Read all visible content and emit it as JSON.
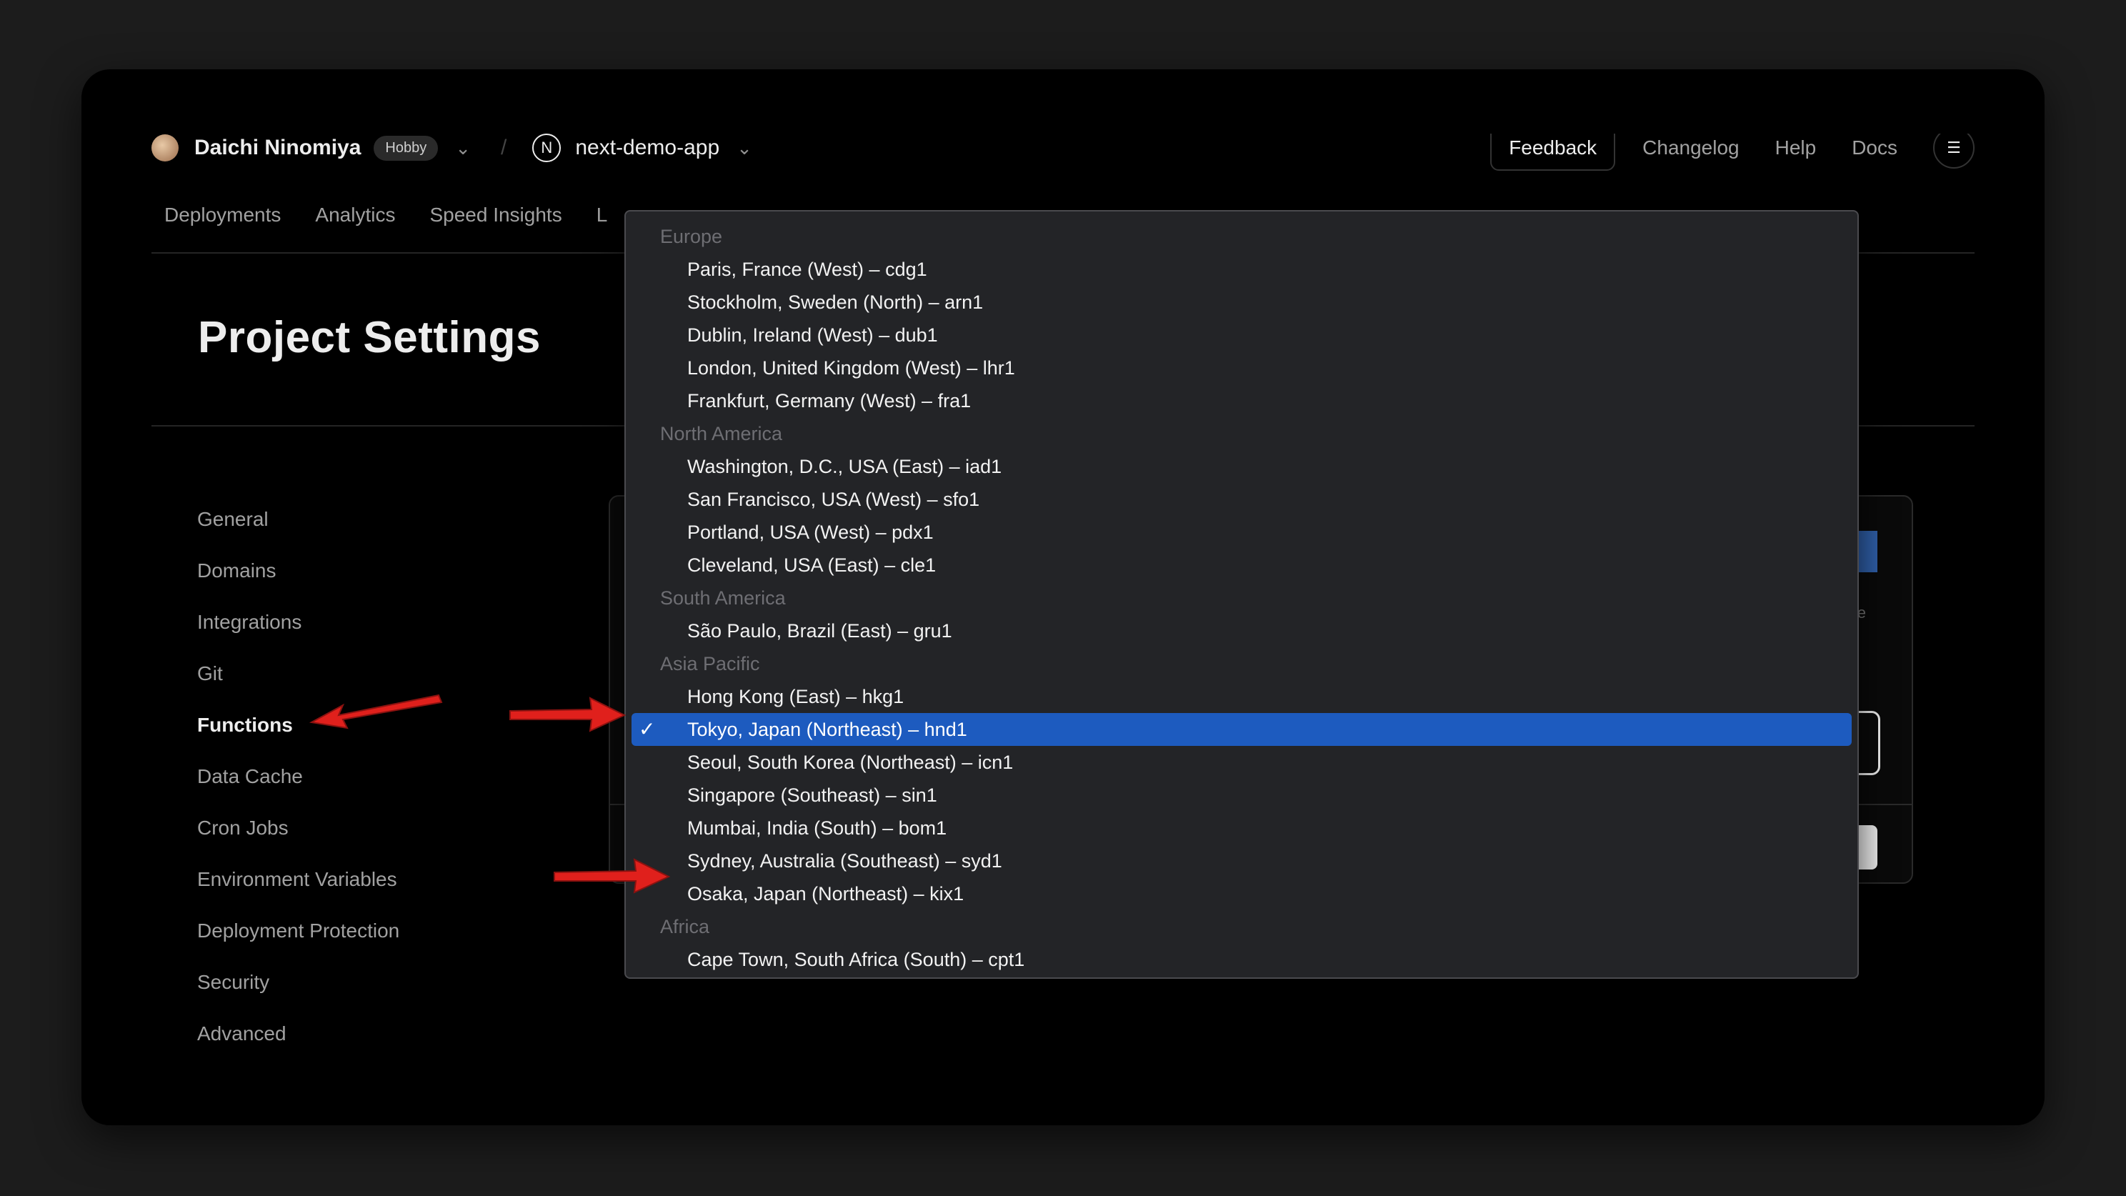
{
  "header": {
    "team_name": "Daichi Ninomiya",
    "plan_badge": "Hobby",
    "project_name": "next-demo-app",
    "project_logo_letter": "N",
    "links": [
      "Feedback",
      "Changelog",
      "Help",
      "Docs"
    ]
  },
  "tabs": [
    "Deployments",
    "Analytics",
    "Speed Insights",
    "L"
  ],
  "page_title": "Project Settings",
  "sidebar": {
    "items": [
      "General",
      "Domains",
      "Integrations",
      "Git",
      "Functions",
      "Data Cache",
      "Cron Jobs",
      "Environment Variables",
      "Deployment Protection",
      "Security",
      "Advanced"
    ],
    "active": "Functions"
  },
  "dropdown": {
    "groups": [
      {
        "label": "Europe",
        "options": [
          "Paris, France (West) – cdg1",
          "Stockholm, Sweden (North) – arn1",
          "Dublin, Ireland (West) – dub1",
          "London, United Kingdom (West) – lhr1",
          "Frankfurt, Germany (West) – fra1"
        ]
      },
      {
        "label": "North America",
        "options": [
          "Washington, D.C., USA (East) – iad1",
          "San Francisco, USA (West) – sfo1",
          "Portland, USA (West) – pdx1",
          "Cleveland, USA (East) – cle1"
        ]
      },
      {
        "label": "South America",
        "options": [
          "São Paulo, Brazil (East) – gru1"
        ]
      },
      {
        "label": "Asia Pacific",
        "options": [
          "Hong Kong (East) – hkg1",
          "Tokyo, Japan (Northeast) – hnd1",
          "Seoul, South Korea (Northeast) – icn1",
          "Singapore (Southeast) – sin1",
          "Mumbai, India (South) – bom1",
          "Sydney, Australia (Southeast) – syd1",
          "Osaka, Japan (Northeast) – kix1"
        ]
      },
      {
        "label": "Africa",
        "options": [
          "Cape Town, South Africa (South) – cpt1"
        ]
      }
    ],
    "selected": "Tokyo, Japan (Northeast) – hnd1",
    "check_glyph": "✓"
  },
  "colors": {
    "selection": "#1d5bbf",
    "annotation_arrow": "#e0201c"
  }
}
